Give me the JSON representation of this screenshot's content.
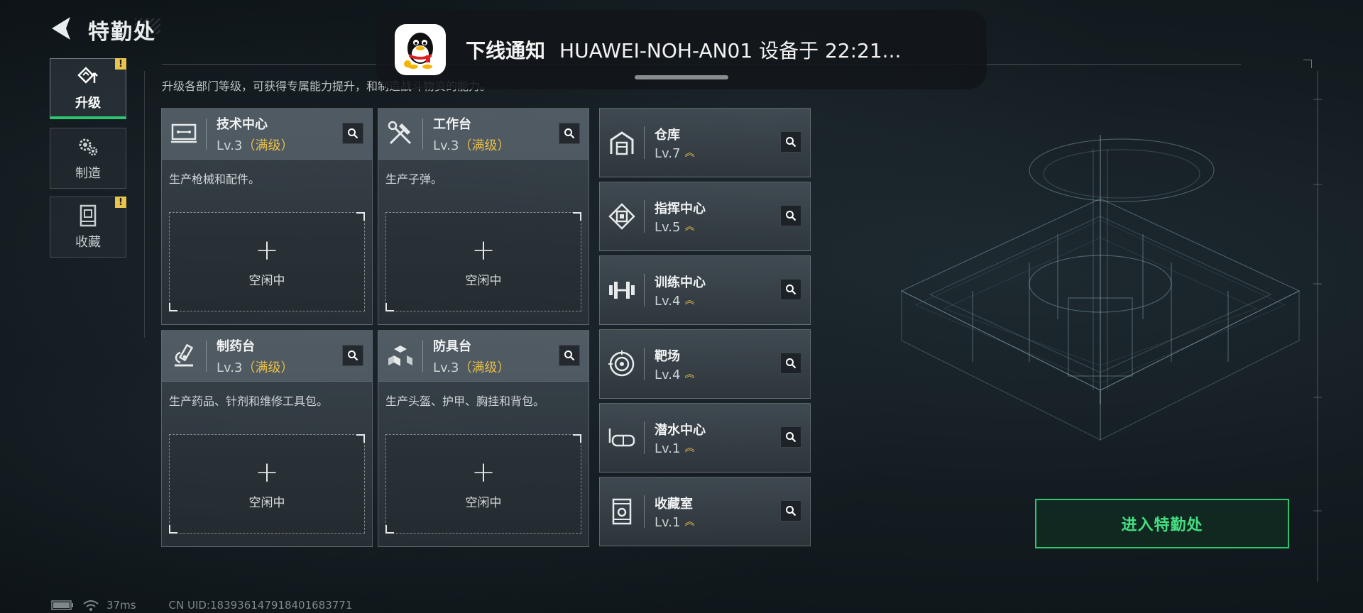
{
  "header": {
    "title": "特勤处",
    "subtitle": "升级各部门等级，可获得专属能力提升，和制造战斗物资的能力。"
  },
  "side_nav": [
    {
      "label": "升级",
      "active": true,
      "badge": "!"
    },
    {
      "label": "制造",
      "active": false,
      "badge": ""
    },
    {
      "label": "收藏",
      "active": false,
      "badge": "!"
    }
  ],
  "stations": [
    {
      "name": "技术中心",
      "level": "Lv.3",
      "max_label": "（满级）",
      "description": "生产枪械和配件。",
      "slot_plus": "+",
      "slot_status": "空闲中",
      "icon": "tech-center-icon"
    },
    {
      "name": "工作台",
      "level": "Lv.3",
      "max_label": "（满级）",
      "description": "生产子弹。",
      "slot_plus": "+",
      "slot_status": "空闲中",
      "icon": "workbench-icon"
    },
    {
      "name": "制药台",
      "level": "Lv.3",
      "max_label": "（满级）",
      "description": "生产药品、针剂和维修工具包。",
      "slot_plus": "+",
      "slot_status": "空闲中",
      "icon": "pharmacy-icon"
    },
    {
      "name": "防具台",
      "level": "Lv.3",
      "max_label": "（满级）",
      "description": "生产头盔、护甲、胸挂和背包。",
      "slot_plus": "+",
      "slot_status": "空闲中",
      "icon": "armor-bench-icon"
    }
  ],
  "facilities": [
    {
      "name": "仓库",
      "level": "Lv.7",
      "icon": "warehouse-icon"
    },
    {
      "name": "指挥中心",
      "level": "Lv.5",
      "icon": "command-center-icon"
    },
    {
      "name": "训练中心",
      "level": "Lv.4",
      "icon": "training-center-icon"
    },
    {
      "name": "靶场",
      "level": "Lv.4",
      "icon": "shooting-range-icon"
    },
    {
      "name": "潜水中心",
      "level": "Lv.1",
      "icon": "diving-center-icon"
    },
    {
      "name": "收藏室",
      "level": "Lv.1",
      "icon": "collection-room-icon"
    }
  ],
  "upgrade_glyph": "︽",
  "enter_button": "进入特勤处",
  "notification": {
    "title": "下线通知",
    "body": "HUAWEI-NOH-AN01 设备于 22:21..."
  },
  "status_bar": {
    "ping": "37ms",
    "uid": "CN UID:183936147918401683771"
  },
  "colors": {
    "accent_green": "#2fc56d",
    "max_level_gold": "#e8bf4a",
    "badge_yellow": "#e9c44d"
  }
}
